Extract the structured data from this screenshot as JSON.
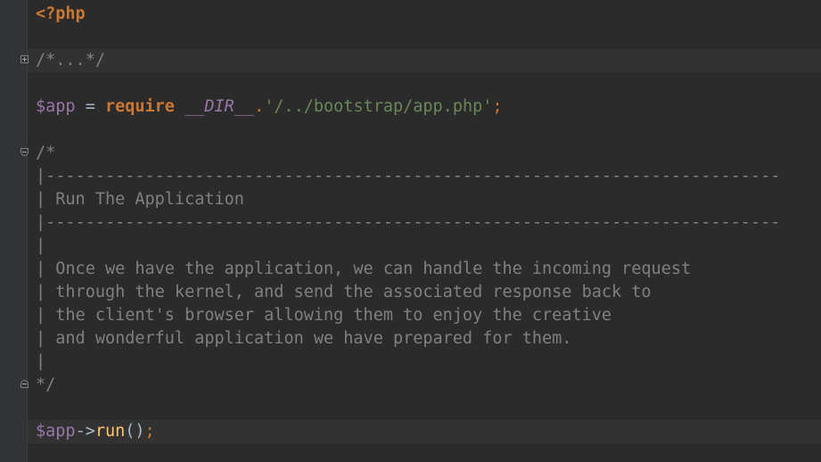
{
  "editor": {
    "lines": {
      "l1": {
        "tag": "<?php"
      },
      "l3": {
        "folded_comment": "/*...*/"
      },
      "l5": {
        "var": "$app",
        "eq": " = ",
        "kw": "require",
        "space": " ",
        "const": "__DIR__",
        "dot": ".",
        "str": "'/../bootstrap/app.php'",
        "semi": ";"
      },
      "l7": {
        "comment": "/*"
      },
      "l8": {
        "comment": "|--------------------------------------------------------------------------"
      },
      "l9": {
        "comment": "| Run The Application"
      },
      "l10": {
        "comment": "|--------------------------------------------------------------------------"
      },
      "l11": {
        "comment": "|"
      },
      "l12": {
        "comment": "| Once we have the application, we can handle the incoming request"
      },
      "l13": {
        "comment": "| through the kernel, and send the associated response back to"
      },
      "l14": {
        "comment": "| the client's browser allowing them to enjoy the creative"
      },
      "l15": {
        "comment": "| and wonderful application we have prepared for them."
      },
      "l16": {
        "comment": "|"
      },
      "l17": {
        "comment": "*/"
      },
      "l19": {
        "var": "$app",
        "arrow": "->",
        "fn": "run",
        "parens": "()",
        "semi": ";"
      }
    }
  }
}
